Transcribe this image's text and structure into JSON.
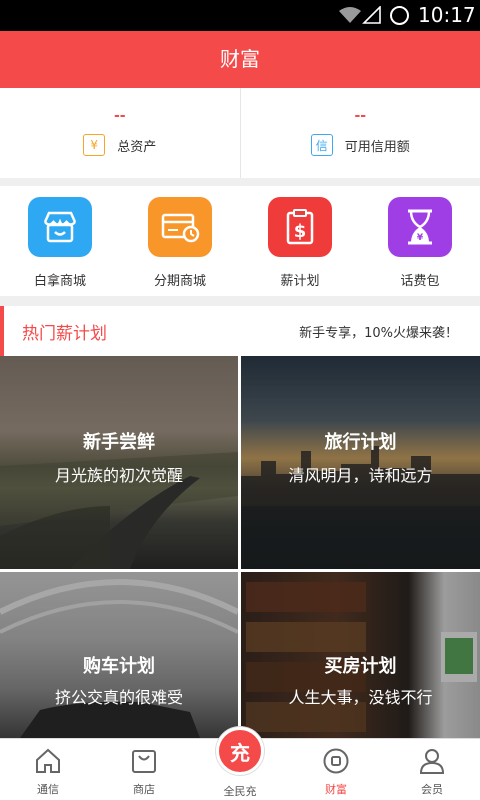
{
  "status_bar": {
    "time": "10:17"
  },
  "header": {
    "title": "财富"
  },
  "assets": [
    {
      "value": "--",
      "icon_glyph": "¥",
      "icon": "yen-icon",
      "label": "总资产"
    },
    {
      "value": "--",
      "icon_glyph": "信",
      "icon": "credit-icon",
      "label": "可用信用额"
    }
  ],
  "entries": [
    {
      "label": "白拿商城",
      "icon": "store-icon",
      "color": "#2fa8f3"
    },
    {
      "label": "分期商城",
      "icon": "card-clock-icon",
      "color": "#f8962a"
    },
    {
      "label": "薪计划",
      "icon": "dollar-clipboard-icon",
      "color": "#f03b3b"
    },
    {
      "label": "话费包",
      "icon": "hourglass-icon",
      "color": "#a03ee6"
    }
  ],
  "section": {
    "title": "热门薪计划",
    "promo": "新手专享，10%火爆来袭！"
  },
  "cards": [
    {
      "title": "新手尝鲜",
      "subtitle": "月光族的初次觉醒"
    },
    {
      "title": "旅行计划",
      "subtitle": "清风明月，诗和远方"
    },
    {
      "title": "购车计划",
      "subtitle": "挤公交真的很难受"
    },
    {
      "title": "买房计划",
      "subtitle": "人生大事，没钱不行"
    }
  ],
  "tabbar": {
    "items": [
      {
        "label": "通信",
        "icon": "home-icon"
      },
      {
        "label": "商店",
        "icon": "shopping-bag-icon"
      },
      {
        "label": "全民充",
        "icon": "charge-icon",
        "fab_text": "充"
      },
      {
        "label": "财富",
        "icon": "wealth-icon",
        "active": true
      },
      {
        "label": "会员",
        "icon": "user-icon"
      }
    ]
  },
  "colors": {
    "brand": "#f44a4a"
  }
}
